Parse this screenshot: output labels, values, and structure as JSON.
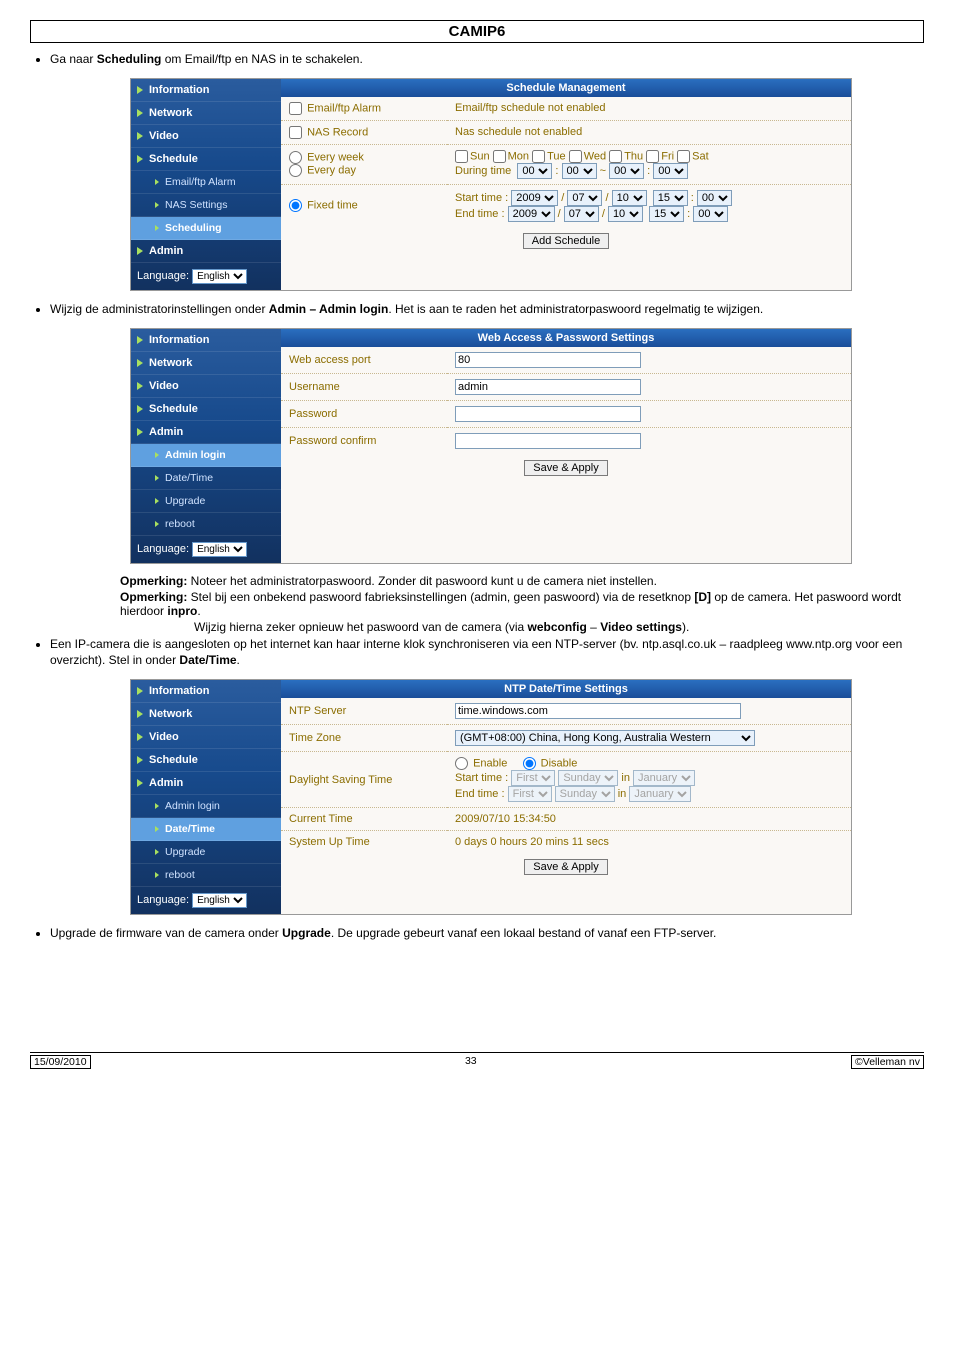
{
  "doc": {
    "title": "CAMIP6",
    "bullet1_pre": "Ga naar ",
    "bullet1_b": "Scheduling",
    "bullet1_post": " om Email/ftp en NAS in te schakelen.",
    "bullet2_pre": "Wijzig de administratorinstellingen onder ",
    "bullet2_b": "Admin – Admin login",
    "bullet2_post": ". Het is aan te raden het administratorpaswoord regelmatig te wijzigen.",
    "opm1_label": "Opmerking:",
    "opm1_text": " Noteer het administratorpaswoord. Zonder dit paswoord kunt u de camera niet instellen.",
    "opm2_label": "Opmerking:",
    "opm2a": " Stel bij een onbekend paswoord fabrieksinstellingen (admin, geen paswoord) via de resetknop ",
    "opm2_b1": "[D]",
    "opm2b": " op de camera. Het paswoord wordt hierdoor ",
    "opm2_b2": "inpro",
    "opm2c": ".",
    "opm2d_pre": "Wijzig hierna zeker opnieuw het paswoord van de camera (via ",
    "opm2d_b1": "webconfig",
    "opm2d_mid": " – ",
    "opm2d_b2": "Video settings",
    "opm2d_post": ").",
    "bullet3": "Een IP-camera die is aangesloten op het internet kan haar interne klok synchroniseren via een NTP-server (bv. ntp.asql.co.uk – raadpleeg www.ntp.org voor een overzicht). Stel in onder ",
    "bullet3_b": "Date/Time",
    "bullet3_post": ".",
    "bullet4_pre": "Upgrade de firmware van de camera onder ",
    "bullet4_b": "Upgrade",
    "bullet4_post": ". De upgrade gebeurt vanaf een lokaal bestand of vanaf een FTP-server."
  },
  "sidebar": {
    "information": "Information",
    "network": "Network",
    "video": "Video",
    "schedule": "Schedule",
    "admin": "Admin",
    "emailftp": "Email/ftp Alarm",
    "nas": "NAS Settings",
    "scheduling": "Scheduling",
    "adminlogin": "Admin login",
    "datetime": "Date/Time",
    "upgrade": "Upgrade",
    "reboot": "reboot",
    "language": "Language:",
    "lang_opt": "English"
  },
  "shot1": {
    "header": "Schedule Management",
    "row1_lbl": "Email/ftp Alarm",
    "row1_txt": "Email/ftp schedule not enabled",
    "row2_lbl": "NAS Record",
    "row2_txt": "Nas schedule not enabled",
    "everyweek": "Every week",
    "everyday": "Every day",
    "days": [
      "Sun",
      "Mon",
      "Tue",
      "Wed",
      "Thu",
      "Fri",
      "Sat"
    ],
    "during": "During time",
    "zero": "00",
    "fixed": "Fixed time",
    "start": "Start time  :",
    "end": "End time  :",
    "y": "2009",
    "m": "07",
    "d": "10",
    "h": "15",
    "mm": "00",
    "btn": "Add Schedule"
  },
  "shot2": {
    "header": "Web Access & Password Settings",
    "port_lbl": "Web access port",
    "port_val": "80",
    "user_lbl": "Username",
    "user_val": "admin",
    "pass_lbl": "Password",
    "conf_lbl": "Password confirm",
    "btn": "Save & Apply"
  },
  "shot3": {
    "header": "NTP Date/Time Settings",
    "ntp_lbl": "NTP Server",
    "ntp_val": "time.windows.com",
    "tz_lbl": "Time Zone",
    "tz_val": "(GMT+08:00) China, Hong Kong, Australia Western",
    "dst_lbl": "Daylight Saving Time",
    "enable": "Enable",
    "disable": "Disable",
    "start": "Start time :",
    "end": "End time  :",
    "first": "First",
    "sunday": "Sunday",
    "in": "in",
    "jan": "January",
    "cur_lbl": "Current Time",
    "cur_val": "2009/07/10 15:34:50",
    "up_lbl": "System Up Time",
    "up_val": "0 days 0 hours 20 mins 11 secs",
    "btn": "Save & Apply"
  },
  "footer": {
    "date": "15/09/2010",
    "page": "33",
    "copy": "©Velleman nv"
  }
}
